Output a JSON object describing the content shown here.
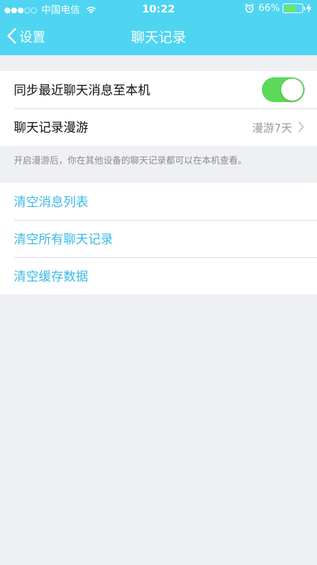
{
  "status_bar": {
    "signal_dots": "●●●○○",
    "carrier": "中国电信",
    "time": "10:22",
    "battery_percent": "66%",
    "battery_level": 0.66
  },
  "nav": {
    "back_label": "设置",
    "title": "聊天记录"
  },
  "settings": {
    "sync_label": "同步最近聊天消息至本机",
    "sync_enabled": true,
    "roaming_label": "聊天记录漫游",
    "roaming_value": "漫游7天",
    "roaming_footnote": "开启漫游后，你在其他设备的聊天记录都可以在本机查看。"
  },
  "actions": [
    {
      "label": "清空消息列表"
    },
    {
      "label": "清空所有聊天记录"
    },
    {
      "label": "清空缓存数据"
    }
  ],
  "colors": {
    "header": "#4fd5f2",
    "accent_link": "#3bb9e6",
    "toggle_on": "#5bd959",
    "background": "#eff0f4"
  },
  "icons": {
    "back": "chevron-left-icon",
    "disclosure": "chevron-right-icon",
    "wifi": "wifi-icon",
    "alarm": "alarm-clock-icon",
    "battery": "battery-icon",
    "charging": "bolt-icon"
  }
}
